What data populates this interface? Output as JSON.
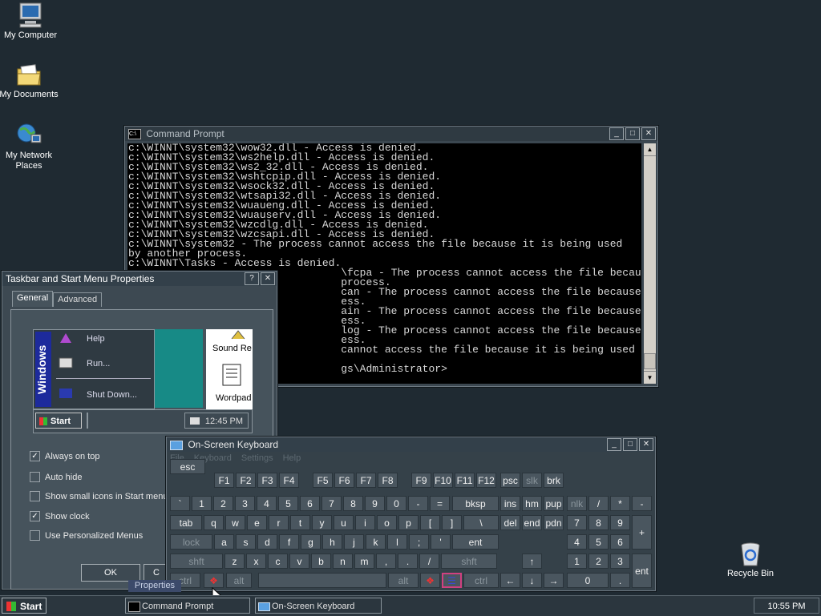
{
  "desktop": {
    "icons": [
      {
        "label": "My Computer",
        "icon": "computer-icon"
      },
      {
        "label": "My Documents",
        "icon": "folder-documents-icon"
      },
      {
        "label": "My Network Places",
        "icon": "network-icon"
      },
      {
        "label": "Recycle Bin",
        "icon": "recycle-bin-icon"
      }
    ]
  },
  "cmd": {
    "title": "Command Prompt",
    "lines": [
      "c:\\WINNT\\system32\\wow32.dll - Access is denied.",
      "c:\\WINNT\\system32\\ws2help.dll - Access is denied.",
      "c:\\WINNT\\system32\\ws2_32.dll - Access is denied.",
      "c:\\WINNT\\system32\\wshtcpip.dll - Access is denied.",
      "c:\\WINNT\\system32\\wsock32.dll - Access is denied.",
      "c:\\WINNT\\system32\\wtsapi32.dll - Access is denied.",
      "c:\\WINNT\\system32\\wuaueng.dll - Access is denied.",
      "c:\\WINNT\\system32\\wuauserv.dll - Access is denied.",
      "c:\\WINNT\\system32\\wzcdlg.dll - Access is denied.",
      "c:\\WINNT\\system32\\wzcsapi.dll - Access is denied.",
      "c:\\WINNT\\system32 - The process cannot access the file because it is being used",
      "by another process.",
      "c:\\WINNT\\Tasks - Access is denied.",
      "                                  \\fcpa - The process cannot access the file because it is",
      "                                  process.",
      "                                  can - The process cannot access the file because it is be",
      "                                  ess.",
      "                                  ain - The process cannot access the file because it is be",
      "                                  ess.",
      "                                  log - The process cannot access the file because it is be",
      "                                  ess.",
      "                                  cannot access the file because it is being used by anothe",
      "",
      "                                  gs\\Administrator>"
    ]
  },
  "props": {
    "title": "Taskbar and Start Menu Properties",
    "tabs": [
      "General",
      "Advanced"
    ],
    "preview": {
      "menu_items": [
        "Help",
        "Run...",
        "Shut Down..."
      ],
      "band_text": "Windows",
      "sound_label": "Sound Re",
      "wordpad_label": "Wordpad",
      "start_label": "Start",
      "clock": "12:45 PM"
    },
    "options": [
      {
        "label": "Always on top",
        "checked": "✓"
      },
      {
        "label": "Auto hide",
        "checked": ""
      },
      {
        "label": "Show small icons in Start menu",
        "checked": ""
      },
      {
        "label": "Show clock",
        "checked": "✓"
      },
      {
        "label": "Use Personalized Menus",
        "checked": ""
      }
    ],
    "ok_label": "OK",
    "cancel_label": "C"
  },
  "osk": {
    "title": "On-Screen Keyboard",
    "menu": [
      "File",
      "Keyboard",
      "Settings",
      "Help"
    ]
  },
  "tooltip": "Properties",
  "taskbar": {
    "start_label": "Start",
    "items": [
      "Command Prompt",
      "On-Screen Keyboard"
    ],
    "clock": "10:55 PM"
  }
}
